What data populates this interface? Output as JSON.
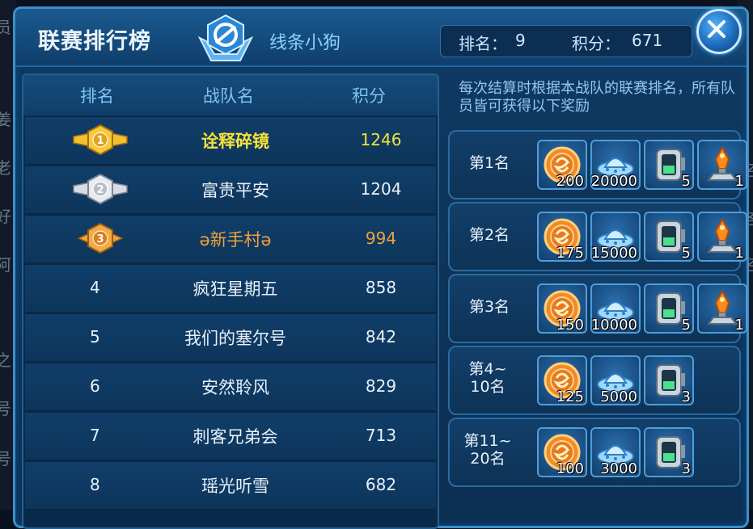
{
  "background": {
    "left_fragments": [
      "员",
      "姜",
      "老",
      "好",
      "阿",
      "之",
      "号",
      "号"
    ],
    "right_fragments": [
      "名",
      "各",
      "名"
    ]
  },
  "header": {
    "title": "联赛排行榜",
    "team_name": "线条小狗",
    "rank_label": "排名：",
    "rank_value": "9",
    "score_label": "积分：",
    "score_value": "671"
  },
  "table": {
    "columns": [
      "排名",
      "战队名",
      "积分"
    ],
    "rows": [
      {
        "rank": "1",
        "name": "诠释碎镜",
        "score": "1246",
        "medal": "gold-medal-icon"
      },
      {
        "rank": "2",
        "name": "富贵平安",
        "score": "1204",
        "medal": "silver-medal-icon"
      },
      {
        "rank": "3",
        "name": "ə新手村ə",
        "score": "994",
        "medal": "bronze-medal-icon"
      },
      {
        "rank": "4",
        "name": "疯狂星期五",
        "score": "858"
      },
      {
        "rank": "5",
        "name": "我们的塞尔号",
        "score": "842"
      },
      {
        "rank": "6",
        "name": "安然聆风",
        "score": "829"
      },
      {
        "rank": "7",
        "name": "刺客兄弟会",
        "score": "713"
      },
      {
        "rank": "8",
        "name": "瑶光听雪",
        "score": "682"
      }
    ]
  },
  "rewards": {
    "description": "每次结算时根据本战队的联赛排名，所有队员皆可获得以下奖励",
    "tiers": [
      {
        "label": "第1名",
        "items": [
          {
            "icon": "coin-icon",
            "qty": "200"
          },
          {
            "icon": "ufo-icon",
            "qty": "20000"
          },
          {
            "icon": "capsule-icon",
            "qty": "5"
          },
          {
            "icon": "trophy-icon",
            "qty": "1"
          }
        ]
      },
      {
        "label": "第2名",
        "items": [
          {
            "icon": "coin-icon",
            "qty": "175"
          },
          {
            "icon": "ufo-icon",
            "qty": "15000"
          },
          {
            "icon": "capsule-icon",
            "qty": "5"
          },
          {
            "icon": "trophy-icon",
            "qty": "1"
          }
        ]
      },
      {
        "label": "第3名",
        "items": [
          {
            "icon": "coin-icon",
            "qty": "150"
          },
          {
            "icon": "ufo-icon",
            "qty": "10000"
          },
          {
            "icon": "capsule-icon",
            "qty": "5"
          },
          {
            "icon": "trophy-icon",
            "qty": "1"
          }
        ]
      },
      {
        "label": "第4~ 10名",
        "items": [
          {
            "icon": "coin-icon",
            "qty": "125"
          },
          {
            "icon": "ufo-icon",
            "qty": "5000"
          },
          {
            "icon": "capsule-icon",
            "qty": "3"
          }
        ]
      },
      {
        "label": "第11~ 20名",
        "items": [
          {
            "icon": "coin-icon",
            "qty": "100"
          },
          {
            "icon": "ufo-icon",
            "qty": "3000"
          },
          {
            "icon": "capsule-icon",
            "qty": "3"
          }
        ]
      }
    ]
  },
  "colors": {
    "gold": "#f4e23a",
    "bronze": "#f0a23a",
    "text": "#e8f1fb",
    "accent": "#8fd0ff"
  }
}
